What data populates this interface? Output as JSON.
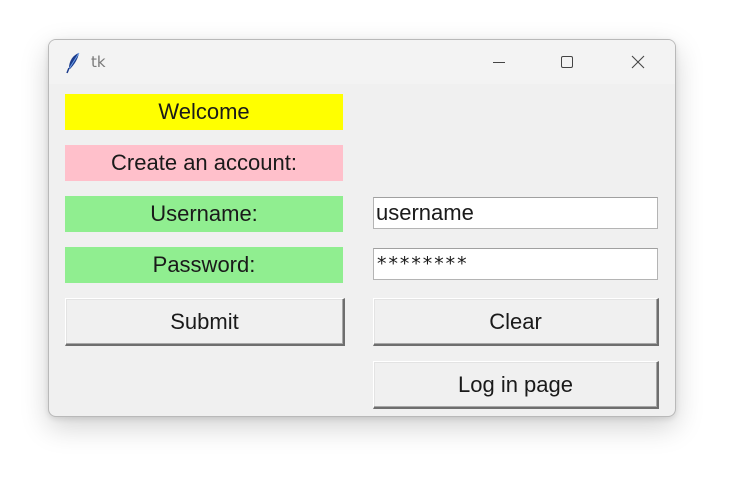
{
  "window": {
    "title": "tk"
  },
  "labels": {
    "welcome": "Welcome",
    "create_account": "Create an account:",
    "username": "Username:",
    "password": "Password:"
  },
  "inputs": {
    "username_value": "username",
    "password_value": "********"
  },
  "buttons": {
    "submit": "Submit",
    "clear": "Clear",
    "login_page": "Log in page"
  },
  "colors": {
    "welcome_bg": "#ffff00",
    "create_bg": "#ffc0cb",
    "field_label_bg": "#90ee90"
  },
  "icons": {
    "app": "feather-icon",
    "minimize": "minimize-icon",
    "maximize": "maximize-icon",
    "close": "close-icon"
  }
}
